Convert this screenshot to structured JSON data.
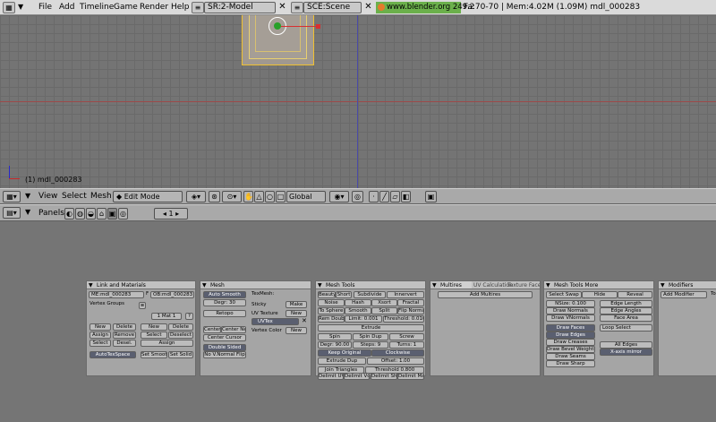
{
  "topbar": {
    "menus": [
      "File",
      "Add",
      "Timeline",
      "Game",
      "Render",
      "Help"
    ],
    "screen_field": "SR:2-Model",
    "scene_field": "SCE:Scene",
    "url_text": "www.blender.org 249.2",
    "stats": "Fa:70-70 | Mem:4.02M (1.09M) mdl_000283"
  },
  "viewport": {
    "object_label": "(1) mdl_000283"
  },
  "header3d": {
    "menus": [
      "View",
      "Select",
      "Mesh"
    ],
    "mode": "Edit Mode",
    "orientation": "Global"
  },
  "buttons_header": {
    "panels_label": "Panels",
    "frame": "1"
  },
  "panels": {
    "link": {
      "title": "Link and Materials",
      "me_field": "ME:mdl_000283",
      "f_label": "F",
      "ob_field": "OB:mdl_000283",
      "vertex_groups": "Vertex Groups",
      "mat": "1 Mat 1",
      "btn_new": "New",
      "btn_delete": "Delete",
      "btn_assign": "Assign",
      "btn_remove": "Remove",
      "btn_select": "Select",
      "btn_desel": "Desel.",
      "btn_new2": "New",
      "btn_delete2": "Delete",
      "btn_select2": "Select",
      "btn_deselect2": "Deselect",
      "btn_assign2": "Assign",
      "autotex": "AutoTexSpace",
      "set_smooth": "Set Smooth",
      "set_solid": "Set Solid"
    },
    "mesh": {
      "title": "Mesh",
      "auto_smooth": "Auto Smooth",
      "degr": "Degr: 30",
      "retopo": "Retopo",
      "texmesh": "TexMesh:",
      "sticky": "Sticky",
      "make": "Make",
      "uv_texture": "UV Texture",
      "new1": "New",
      "uvtex": "UVTex",
      "vertex_color": "Vertex Color",
      "new2": "New",
      "center": "Center",
      "center_new": "Center New",
      "center_cursor": "Center Cursor",
      "double_sided": "Double Sided",
      "no_vnormal": "No V.Normal Flip"
    },
    "mesh_tools": {
      "title": "Mesh Tools",
      "beauty": "Beauty",
      "short": "Short",
      "subdivide": "Subdivide",
      "innervert": "Innervert",
      "noise": "Noise",
      "hash": "Hash",
      "xsort": "Xsort",
      "fractal": "Fractal",
      "to_sphere": "To Sphere",
      "smooth": "Smooth",
      "split": "Split",
      "flip_normals": "Flip Normals",
      "rem_double": "Rem Double",
      "limit": "Limit: 0.001",
      "threshold": "Threshold: 0.010",
      "extrude": "Extrude",
      "spin": "Spin",
      "spin_dup": "Spin Dup",
      "screw": "Screw",
      "degr90": "Degr: 90.00",
      "steps": "Steps: 9",
      "turns": "Turns: 1",
      "keep_original": "Keep Original",
      "clockwise": "Clockwise",
      "extrude_dup": "Extrude Dup",
      "offset": "Offset: 1.00",
      "join_triangles": "Join Triangles",
      "threshold2": "Threshold 0.800",
      "delimit1": "Delimit UVs",
      "delimit2": "Delimit Vcol",
      "delimit3": "Delimit Sharp",
      "delimit4": "Delimit Mat"
    },
    "multires": {
      "tab1": "Multires",
      "tab2": "UV Calculation",
      "tab3": "Texture Face",
      "add_multires": "Add Multires"
    },
    "mesh_tools_more": {
      "title": "Mesh Tools More",
      "select_swap": "Select Swap",
      "hide": "Hide",
      "reveal": "Reveal",
      "nsize": "NSize: 0.100",
      "edge_length": "Edge Length",
      "draw_normals": "Draw Normals",
      "edge_angles": "Edge Angles",
      "draw_vnormals": "Draw VNormals",
      "face_area": "Face Area",
      "draw_faces": "Draw Faces",
      "loop_select": "Loop Select",
      "draw_edges": "Draw Edges",
      "draw_creases": "Draw Creases",
      "draw_bevel": "Draw Bevel Weights",
      "all_edges": "All Edges",
      "draw_seams": "Draw Seams",
      "xaxis_mirror": "X-axis mirror",
      "draw_sharp": "Draw Sharp"
    },
    "modifiers": {
      "title": "Modifiers",
      "add_modifier": "Add Modifier",
      "to": "To"
    }
  },
  "colors": {
    "selected_button": "#5a5f70",
    "url_badge": "#6bb04b",
    "selection_outline": "#f0c030"
  }
}
